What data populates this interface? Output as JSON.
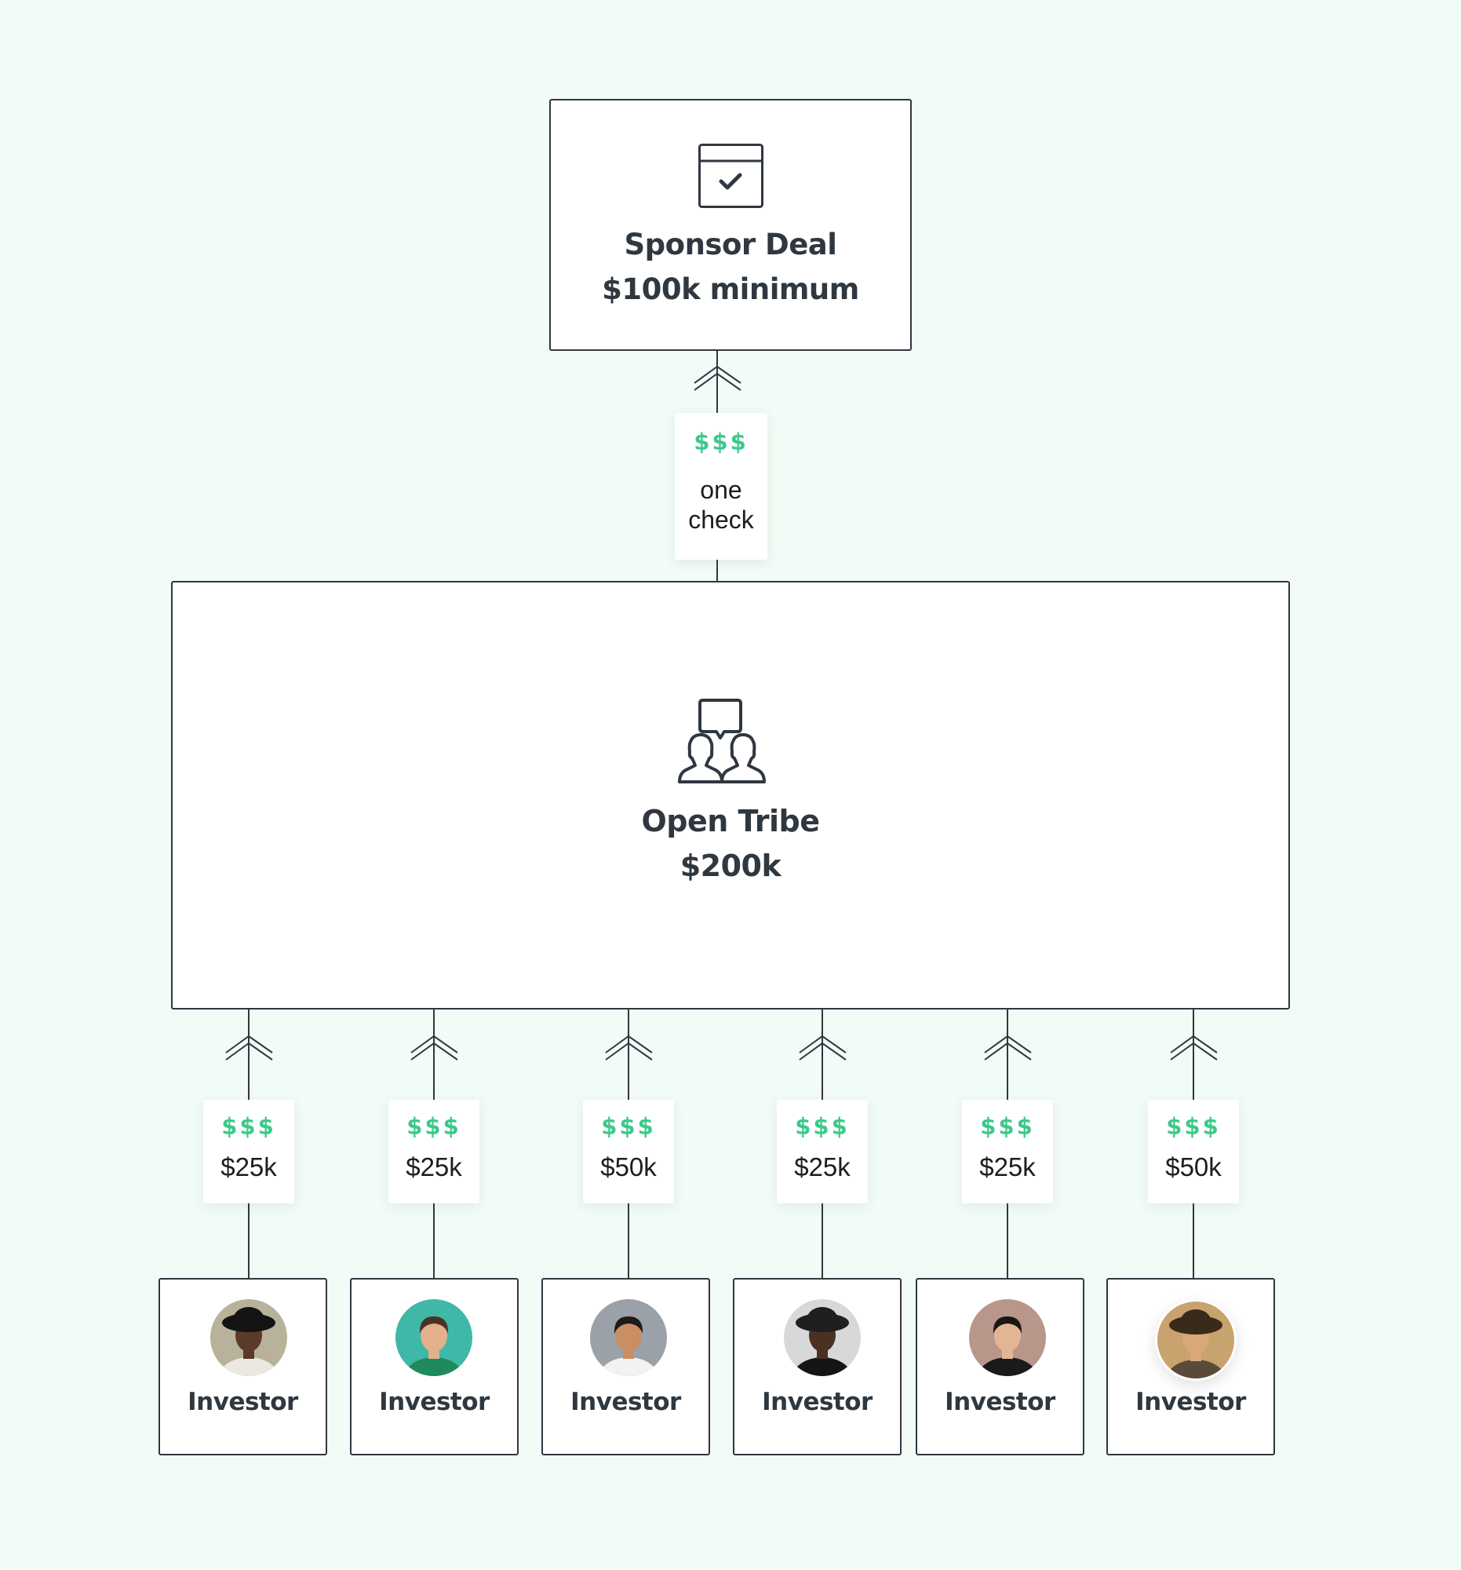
{
  "colors": {
    "background": "#f2fbf6",
    "ink": "#2f3740",
    "money_green": "#3dc98b",
    "box_fill": "#ffffff"
  },
  "sponsor": {
    "icon": "calendar-check-icon",
    "title": "Sponsor Deal",
    "subtitle": "$100k minimum"
  },
  "sponsor_link": {
    "icon": "double-chevron-up-icon",
    "dollars": "$$$",
    "line1": "one",
    "line2": "check"
  },
  "tribe": {
    "icon": "group-chat-icon",
    "title": "Open Tribe",
    "amount": "$200k"
  },
  "investors": [
    {
      "label": "Investor",
      "amount": "$25k",
      "dollars": "$$$",
      "avatar": "woman-black-hat"
    },
    {
      "label": "Investor",
      "amount": "$25k",
      "dollars": "$$$",
      "avatar": "man-green-shirt"
    },
    {
      "label": "Investor",
      "amount": "$50k",
      "dollars": "$$$",
      "avatar": "man-smiling-white-tee"
    },
    {
      "label": "Investor",
      "amount": "$25k",
      "dollars": "$$$",
      "avatar": "man-beanie-beard"
    },
    {
      "label": "Investor",
      "amount": "$25k",
      "dollars": "$$$",
      "avatar": "woman-black-blazer"
    },
    {
      "label": "Investor",
      "amount": "$50k",
      "dollars": "$$$",
      "avatar": "woman-wide-hat"
    }
  ]
}
